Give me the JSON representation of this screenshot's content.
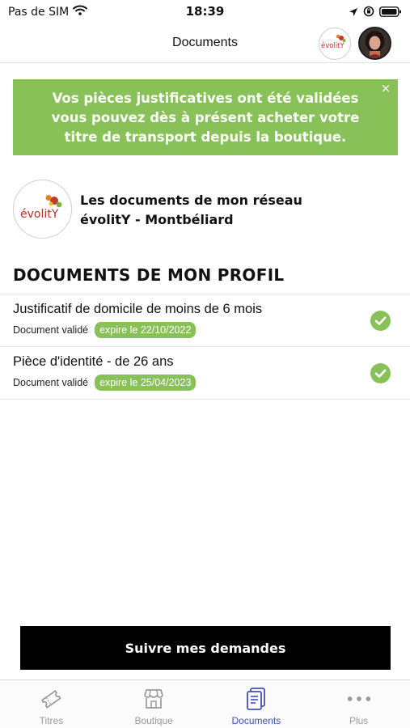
{
  "status_bar": {
    "carrier": "Pas de SIM",
    "time": "18:39"
  },
  "nav": {
    "title": "Documents",
    "logo_text": "évolitY"
  },
  "banner": {
    "message": "Vos pièces justificatives ont été validées vous pouvez dès à présent acheter votre titre de transport depuis la boutique.",
    "close_symbol": "×"
  },
  "network": {
    "logo_text": "évolitY",
    "line1": "Les documents de mon réseau",
    "line2": "évolitY - Montbéliard"
  },
  "section_title": "DOCUMENTS DE MON PROFIL",
  "documents": [
    {
      "title": "Justificatif de domicile de moins de 6 mois",
      "status": "Document validé",
      "expiry": "expire le 22/10/2022"
    },
    {
      "title": "Pièce d'identité - de 26 ans",
      "status": "Document validé",
      "expiry": "expire le 25/04/2023"
    }
  ],
  "follow_button": "Suivre mes demandes",
  "tabs": [
    {
      "label": "Titres",
      "icon": "ticket-icon"
    },
    {
      "label": "Boutique",
      "icon": "shop-icon"
    },
    {
      "label": "Documents",
      "icon": "document-icon",
      "active": true
    },
    {
      "label": "Plus",
      "icon": "more-icon"
    }
  ],
  "colors": {
    "accent_green": "#89c159",
    "active_tab": "#3f51b5",
    "button_bg": "#000000"
  }
}
